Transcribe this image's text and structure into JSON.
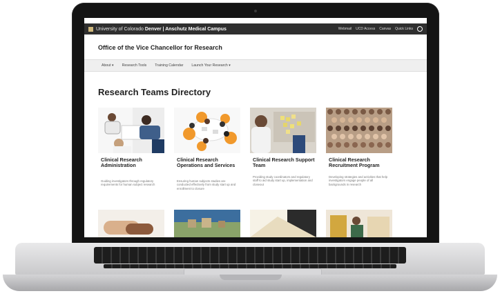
{
  "site": {
    "university": "University of Colorado",
    "campus": "Denver | Anschutz Medical Campus",
    "top_links": [
      "Webmail",
      "UCD Access",
      "Canvas",
      "Quick Links"
    ],
    "office_title": "Office of the Vice Chancellor for Research"
  },
  "nav": {
    "items": [
      "About ▾",
      "Research Tools",
      "Training Calendar",
      "Launch Your Research ▾"
    ]
  },
  "page": {
    "heading": "Research Teams Directory"
  },
  "cards": [
    {
      "title": "Clinical Research Administration",
      "desc": "Guiding investigators through regulatory requirements for human subject research"
    },
    {
      "title": "Clinical Research Operations and Services",
      "desc": "Ensuring human subjects studies are conducted effectively from study start up and enrollment to closure"
    },
    {
      "title": "Clinical Research Support Team",
      "desc": "Providing study coordinators and regulatory staff to aid study start up, implementation and closeout"
    },
    {
      "title": "Clinical Research Recruitment Program",
      "desc": "Developing strategies and activities that help investigators engage people of all backgrounds in research"
    }
  ]
}
